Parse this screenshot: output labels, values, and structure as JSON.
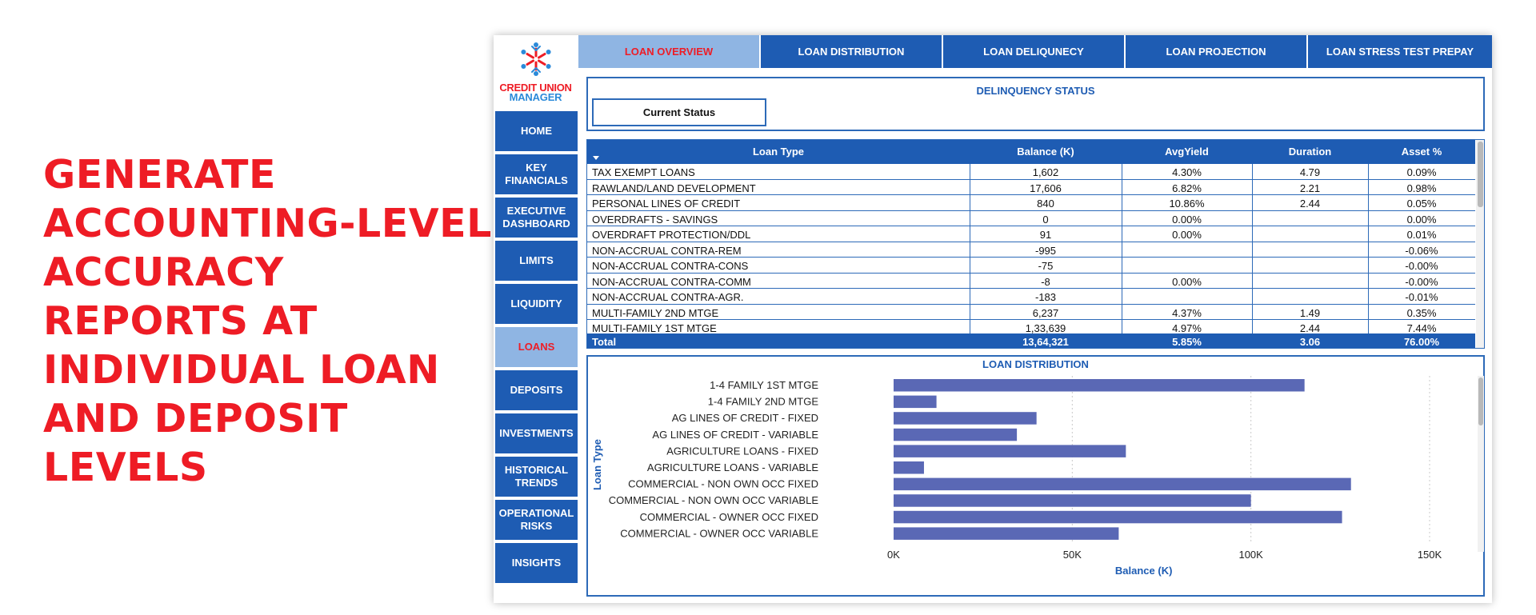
{
  "headline": [
    "GENERATE",
    "ACCOUNTING-LEVEL",
    "ACCURACY",
    "REPORTS AT",
    "INDIVIDUAL LOAN",
    "AND DEPOSIT",
    "LEVELS"
  ],
  "logo": {
    "line1": "CREDIT UNION",
    "line2": "MANAGER",
    "icon": "snowflake-people-logo"
  },
  "sidebar": {
    "items": [
      {
        "label": "HOME"
      },
      {
        "label": "KEY FINANCIALS"
      },
      {
        "label": "EXECUTIVE DASHBOARD"
      },
      {
        "label": "LIMITS"
      },
      {
        "label": "LIQUIDITY"
      },
      {
        "label": "LOANS"
      },
      {
        "label": "DEPOSITS"
      },
      {
        "label": "INVESTMENTS"
      },
      {
        "label": "HISTORICAL TRENDS"
      },
      {
        "label": "OPERATIONAL RISKS"
      },
      {
        "label": "INSIGHTS"
      }
    ],
    "active_index": 5
  },
  "tabs": {
    "items": [
      {
        "label": "LOAN OVERVIEW"
      },
      {
        "label": "LOAN DISTRIBUTION"
      },
      {
        "label": "LOAN DELIQUNECY"
      },
      {
        "label": "LOAN PROJECTION"
      },
      {
        "label": "LOAN STRESS TEST PREPAY"
      }
    ],
    "active_index": 0
  },
  "delinquency": {
    "title": "DELINQUENCY STATUS",
    "status_label": "Current Status"
  },
  "table": {
    "columns": [
      "Loan Type",
      "Balance (K)",
      "AvgYield",
      "Duration",
      "Asset %"
    ],
    "rows": [
      [
        "TAX EXEMPT LOANS",
        "1,602",
        "4.30%",
        "4.79",
        "0.09%"
      ],
      [
        "RAWLAND/LAND DEVELOPMENT",
        "17,606",
        "6.82%",
        "2.21",
        "0.98%"
      ],
      [
        "PERSONAL LINES OF CREDIT",
        "840",
        "10.86%",
        "2.44",
        "0.05%"
      ],
      [
        "OVERDRAFTS - SAVINGS",
        "0",
        "0.00%",
        "",
        "0.00%"
      ],
      [
        "OVERDRAFT PROTECTION/DDL",
        "91",
        "0.00%",
        "",
        "0.01%"
      ],
      [
        "NON-ACCRUAL CONTRA-REM",
        "-995",
        "",
        "",
        "-0.06%"
      ],
      [
        "NON-ACCRUAL CONTRA-CONS",
        "-75",
        "",
        "",
        "-0.00%"
      ],
      [
        "NON-ACCRUAL CONTRA-COMM",
        "-8",
        "0.00%",
        "",
        "-0.00%"
      ],
      [
        "NON-ACCRUAL CONTRA-AGR.",
        "-183",
        "",
        "",
        "-0.01%"
      ],
      [
        "MULTI-FAMILY 2ND MTGE",
        "6,237",
        "4.37%",
        "1.49",
        "0.35%"
      ],
      [
        "MULTI-FAMILY 1ST MTGE",
        "1,33,639",
        "4.97%",
        "2.44",
        "7.44%"
      ]
    ],
    "total": [
      "Total",
      "13,64,321",
      "5.85%",
      "3.06",
      "76.00%"
    ]
  },
  "chart_data": {
    "type": "bar",
    "orientation": "horizontal",
    "title": "LOAN DISTRIBUTION",
    "xlabel": "Balance (K)",
    "ylabel": "Loan Type",
    "xlim": [
      0,
      160000
    ],
    "xticks": [
      0,
      50000,
      100000,
      150000
    ],
    "xtick_labels": [
      "0K",
      "50K",
      "100K",
      "150K"
    ],
    "grid": true,
    "color": "#5a68b5",
    "categories": [
      "1-4 FAMILY 1ST MTGE",
      "1-4 FAMILY 2ND MTGE",
      "AG LINES OF CREDIT - FIXED",
      "AG LINES OF CREDIT - VARIABLE",
      "AGRICULTURE LOANS - FIXED",
      "AGRICULTURE LOANS - VARIABLE",
      "COMMERCIAL - NON OWN OCC FIXED",
      "COMMERCIAL - NON OWN OCC VARIABLE",
      "COMMERCIAL - OWNER OCC FIXED",
      "COMMERCIAL - OWNER OCC VARIABLE"
    ],
    "values": [
      115000,
      12000,
      40000,
      34500,
      65000,
      8500,
      128000,
      100000,
      125500,
      63000
    ]
  }
}
